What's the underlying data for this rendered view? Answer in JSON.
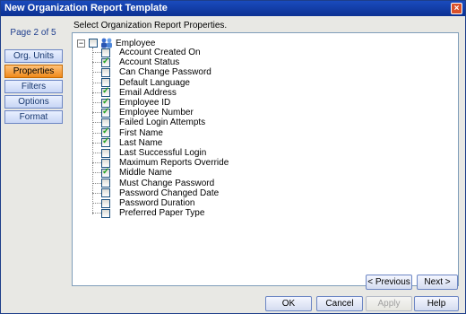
{
  "window": {
    "title": "New Organization Report Template",
    "close_glyph": "×"
  },
  "sidebar": {
    "page_indicator": "Page 2 of 5",
    "items": [
      {
        "label": "Org. Units",
        "active": false
      },
      {
        "label": "Properties",
        "active": true
      },
      {
        "label": "Filters",
        "active": false
      },
      {
        "label": "Options",
        "active": false
      },
      {
        "label": "Format",
        "active": false
      }
    ]
  },
  "main": {
    "instruction": "Select Organization Report Properties.",
    "tree": {
      "root": {
        "label": "Employee",
        "expander": "−",
        "checked": false
      },
      "items": [
        {
          "label": "Account Created On",
          "checked": false
        },
        {
          "label": "Account Status",
          "checked": true
        },
        {
          "label": "Can Change Password",
          "checked": false
        },
        {
          "label": "Default Language",
          "checked": false
        },
        {
          "label": "Email Address",
          "checked": true
        },
        {
          "label": "Employee ID",
          "checked": true
        },
        {
          "label": "Employee Number",
          "checked": true
        },
        {
          "label": "Failed Login Attempts",
          "checked": false
        },
        {
          "label": "First Name",
          "checked": true
        },
        {
          "label": "Last Name",
          "checked": true
        },
        {
          "label": "Last Successful Login",
          "checked": false
        },
        {
          "label": "Maximum Reports Override",
          "checked": false
        },
        {
          "label": "Middle Name",
          "checked": true
        },
        {
          "label": "Must Change Password",
          "checked": false
        },
        {
          "label": "Password Changed Date",
          "checked": false
        },
        {
          "label": "Password Duration",
          "checked": false
        },
        {
          "label": "Preferred Paper Type",
          "checked": false
        }
      ]
    }
  },
  "buttons": {
    "previous": "< Previous",
    "next": "Next >",
    "ok": "OK",
    "cancel": "Cancel",
    "apply": "Apply",
    "help": "Help"
  },
  "colors": {
    "title_bar": "#0c3192",
    "active_nav": "#f08a1a",
    "check": "#21a121"
  }
}
